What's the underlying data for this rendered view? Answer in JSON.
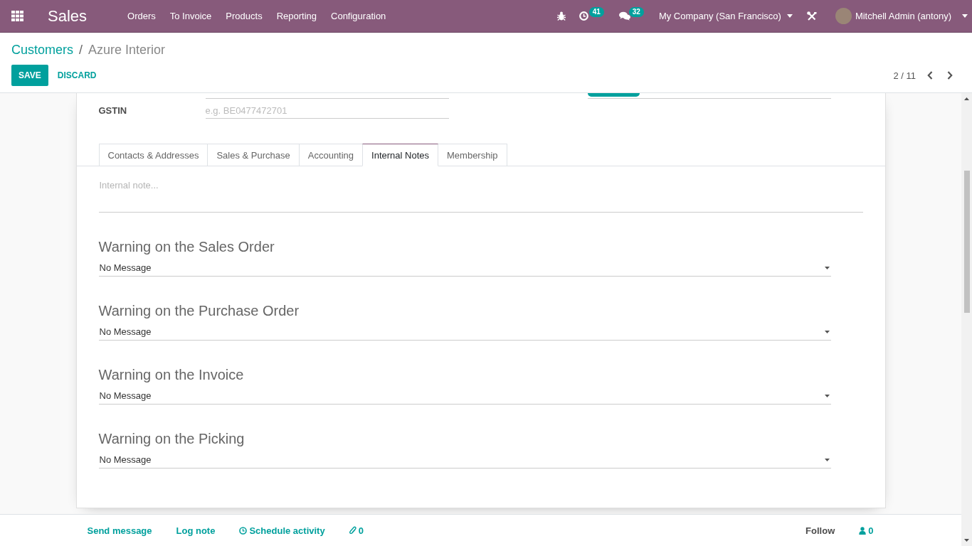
{
  "navbar": {
    "app_name": "Sales",
    "menus": [
      "Orders",
      "To Invoice",
      "Products",
      "Reporting",
      "Configuration"
    ],
    "activity_count": "41",
    "message_count": "32",
    "company": "My Company (San Francisco)",
    "user": "Mitchell Admin (antony)"
  },
  "breadcrumbs": [
    {
      "label": "Customers",
      "kind": "link"
    },
    {
      "label": "/",
      "kind": "separator"
    },
    {
      "label": "Azure Interior",
      "kind": "current"
    }
  ],
  "actions": [
    {
      "label": "SAVE",
      "kind": "primary"
    },
    {
      "label": "DISCARD",
      "kind": "link"
    }
  ],
  "pager": {
    "value": "2 / 11"
  },
  "sheet": {
    "fields": [
      {
        "label": "GSTIN",
        "placeholder": "e.g. BE0477472701"
      }
    ],
    "tabs": [
      {
        "label": "Contacts & Addresses",
        "selected": false
      },
      {
        "label": "Sales & Purchase",
        "selected": false
      },
      {
        "label": "Accounting",
        "selected": false
      },
      {
        "label": "Internal Notes",
        "selected": true
      },
      {
        "label": "Membership",
        "selected": false
      }
    ],
    "internal_note": {
      "placeholder": "Internal note..."
    },
    "warnings": [
      {
        "title": "Warning on the Sales Order",
        "value": "No Message"
      },
      {
        "title": "Warning on the Purchase Order",
        "value": "No Message"
      },
      {
        "title": "Warning on the Invoice",
        "value": "No Message"
      },
      {
        "title": "Warning on the Picking",
        "value": "No Message"
      }
    ]
  },
  "chatter": {
    "actions": [
      {
        "kind": "text",
        "label": "Send message"
      },
      {
        "kind": "text",
        "label": "Log note"
      },
      {
        "kind": "clock",
        "label": "Schedule activity"
      },
      {
        "kind": "paperclip",
        "label": "0"
      }
    ],
    "follow": "Follow",
    "followers": "0"
  }
}
